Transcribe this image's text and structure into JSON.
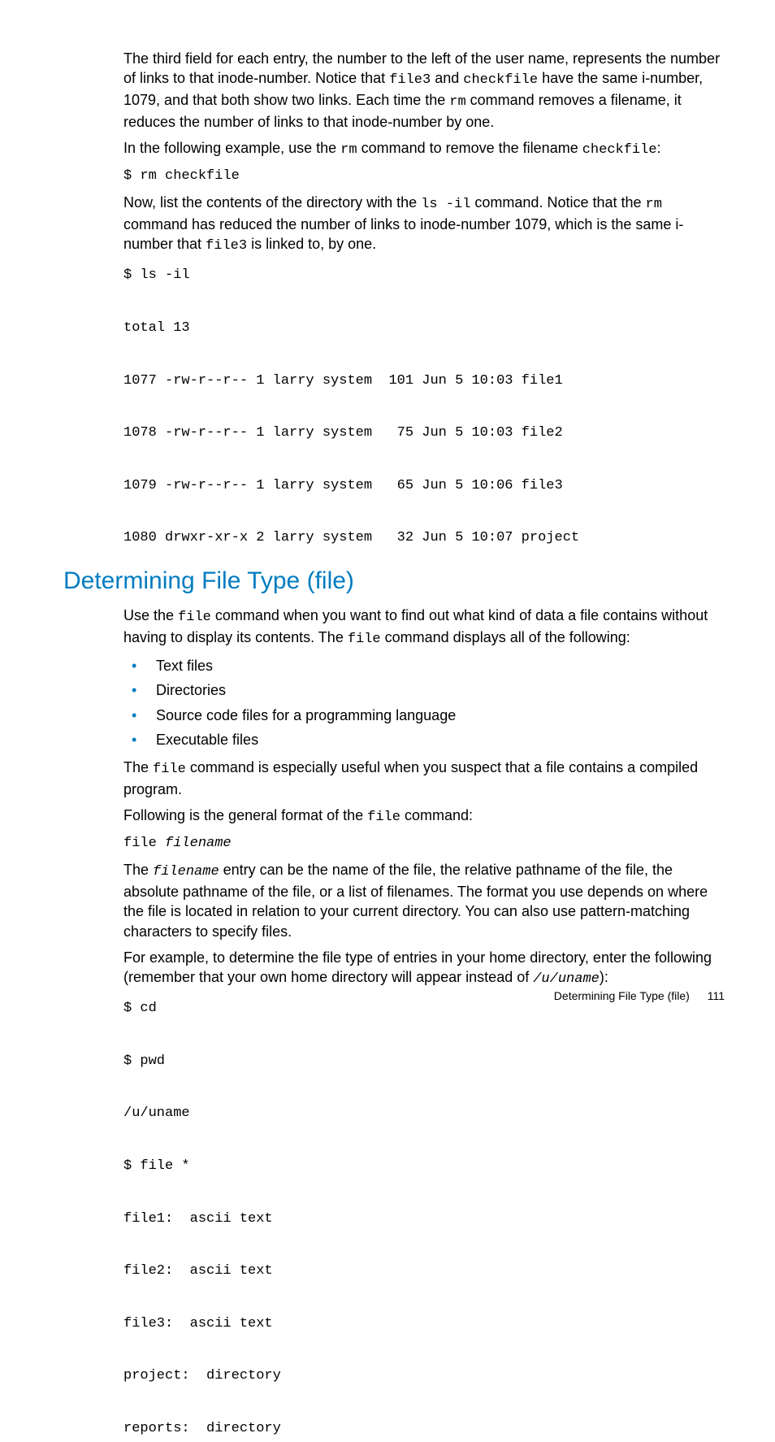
{
  "para1_a": "The third field for each entry, the number to the left of the user name, represents the number of links to that inode-number. Notice that ",
  "para1_code1": "file3",
  "para1_b": " and ",
  "para1_code2": "checkfile",
  "para1_c": " have the same i-number, 1079, and that both show two links. Each time the ",
  "para1_code3": "rm",
  "para1_d": " command removes a filename, it reduces the number of links to that inode-number by one.",
  "para2_a": "In the following example, use the ",
  "para2_code1": "rm",
  "para2_b": " command to remove the filename ",
  "para2_code2": "checkfile",
  "para2_c": ":",
  "code_rm": "$ rm checkfile",
  "para3_a": "Now, list the contents of the directory with the ",
  "para3_code1": "ls -il",
  "para3_b": " command. Notice that the ",
  "para3_code2": "rm",
  "para3_c": " command has reduced the number of links to inode-number 1079, which is the same i-number that ",
  "para3_code3": "file3",
  "para3_d": " is linked to, by one.",
  "code_ls": "$ ls -il\n\ntotal 13\n\n1077 -rw-r--r-- 1 larry system  101 Jun 5 10:03 file1\n\n1078 -rw-r--r-- 1 larry system   75 Jun 5 10:03 file2\n\n1079 -rw-r--r-- 1 larry system   65 Jun 5 10:06 file3\n\n1080 drwxr-xr-x 2 larry system   32 Jun 5 10:07 project",
  "section_heading": "Determining File Type (file)",
  "para4_a": "Use the ",
  "para4_code1": "file",
  "para4_b": " command when you want to find out what kind of data a file contains without having to display its contents. The ",
  "para4_code2": "file",
  "para4_c": " command displays all of the following:",
  "bullets": {
    "b1": "Text files",
    "b2": "Directories",
    "b3": "Source code files for a programming language",
    "b4": "Executable files"
  },
  "para5_a": "The ",
  "para5_code1": "file",
  "para5_b": " command is especially useful when you suspect that a file contains a compiled program.",
  "para6_a": "Following is the general format of the ",
  "para6_code1": "file",
  "para6_b": " command:",
  "code_file_syntax_a": "file ",
  "code_file_syntax_b": "filename",
  "para7_a": "The ",
  "para7_code1": "filename",
  "para7_b": " entry can be the name of the file, the relative pathname of the file, the absolute pathname of the file, or a list of filenames. The format you use depends on where the file is located in relation to your current directory. You can also use pattern-matching characters to specify files.",
  "para8_a": "For example, to determine the file type of entries in your home directory, enter the following (remember that your own home directory will appear instead of ",
  "para8_code1": "/u/uname",
  "para8_b": "):",
  "code_file_example": "$ cd\n\n$ pwd\n\n/u/uname\n\n$ file *\n\nfile1:  ascii text\n\nfile2:  ascii text\n\nfile3:  ascii text\n\nproject:  directory\n\nreports:  directory",
  "footer_text": "Determining File Type (file)",
  "footer_page": "111"
}
